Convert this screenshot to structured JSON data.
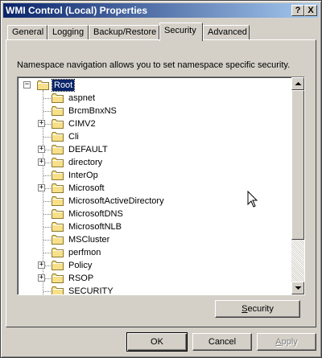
{
  "window": {
    "title": "WMI Control (Local) Properties",
    "help_label": "?",
    "close_label": "X"
  },
  "tabs": [
    {
      "label": "General",
      "active": false
    },
    {
      "label": "Logging",
      "active": false
    },
    {
      "label": "Backup/Restore",
      "active": false
    },
    {
      "label": "Security",
      "active": true
    },
    {
      "label": "Advanced",
      "active": false
    }
  ],
  "description": "Namespace navigation allows you to set namespace specific security.",
  "tree": {
    "root": {
      "label": "Root",
      "expanded": true,
      "selected": true
    },
    "children": [
      {
        "label": "aspnet",
        "expandable": false
      },
      {
        "label": "BrcmBnxNS",
        "expandable": false
      },
      {
        "label": "CIMV2",
        "expandable": true
      },
      {
        "label": "Cli",
        "expandable": false
      },
      {
        "label": "DEFAULT",
        "expandable": true
      },
      {
        "label": "directory",
        "expandable": true
      },
      {
        "label": "InterOp",
        "expandable": false
      },
      {
        "label": "Microsoft",
        "expandable": true
      },
      {
        "label": "MicrosoftActiveDirectory",
        "expandable": false
      },
      {
        "label": "MicrosoftDNS",
        "expandable": false
      },
      {
        "label": "MicrosoftNLB",
        "expandable": false
      },
      {
        "label": "MSCluster",
        "expandable": false
      },
      {
        "label": "perfmon",
        "expandable": false
      },
      {
        "label": "Policy",
        "expandable": true
      },
      {
        "label": "RSOP",
        "expandable": true
      },
      {
        "label": "SECURITY",
        "expandable": false
      }
    ]
  },
  "buttons": {
    "security": {
      "prefix": "",
      "mnemonic": "S",
      "suffix": "ecurity"
    },
    "ok": "OK",
    "cancel": "Cancel",
    "apply": {
      "mnemonic": "A",
      "suffix": "pply"
    }
  },
  "colors": {
    "title_start": "#0a246a",
    "title_end": "#a6caf0",
    "face": "#d4d0c8",
    "selection": "#0a246a",
    "folder": "#f8e08a"
  }
}
